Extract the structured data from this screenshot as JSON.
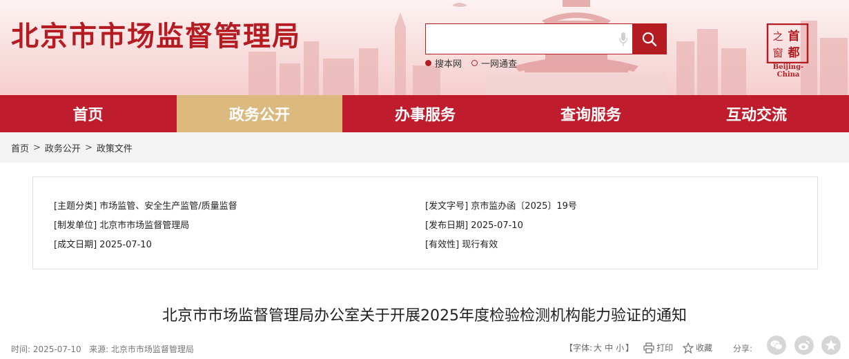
{
  "header": {
    "site_title": "北京市市场监督管理局",
    "search": {
      "placeholder": "",
      "value": "",
      "scope_options": [
        "搜本网",
        "一网通查"
      ],
      "selected_scope": "搜本网"
    },
    "logo": {
      "chars": [
        "首",
        "都",
        "之",
        "窗"
      ],
      "caption": "Beijing-China"
    },
    "accent_color": "#b51c22"
  },
  "nav": {
    "items": [
      "首页",
      "政务公开",
      "办事服务",
      "查询服务",
      "互动交流"
    ],
    "active": "政务公开",
    "bar_color": "#bf1c2d",
    "active_color": "#dbb97f"
  },
  "breadcrumb": {
    "items": [
      "首页",
      "政务公开",
      "政策文件"
    ],
    "separator": ">"
  },
  "meta": {
    "topic_label": "[主题分类]",
    "topic_value": "市场监管、安全生产监管/质量监督",
    "doc_no_label": "[发文字号]",
    "doc_no_value": "京市监办函〔2025〕19号",
    "issuer_label": "[制发单位]",
    "issuer_value": "北京市市场监督管理局",
    "publish_label": "[发布日期]",
    "publish_value": "2025-07-10",
    "created_label": "[成文日期]",
    "created_value": "2025-07-10",
    "validity_label": "[有效性]",
    "validity_value": "现行有效"
  },
  "article": {
    "title": "北京市市场监督管理局办公室关于开展2025年度检验检测机构能力验证的通知",
    "time": "时间: 2025-07-10",
    "source": "来源: 北京市市场监督管理局"
  },
  "tools": {
    "font_prefix": "【字体:",
    "sizes": [
      "大",
      "中",
      "小"
    ],
    "font_suffix": "】",
    "print": "打印",
    "favorite": "收藏",
    "share": "分享:"
  }
}
